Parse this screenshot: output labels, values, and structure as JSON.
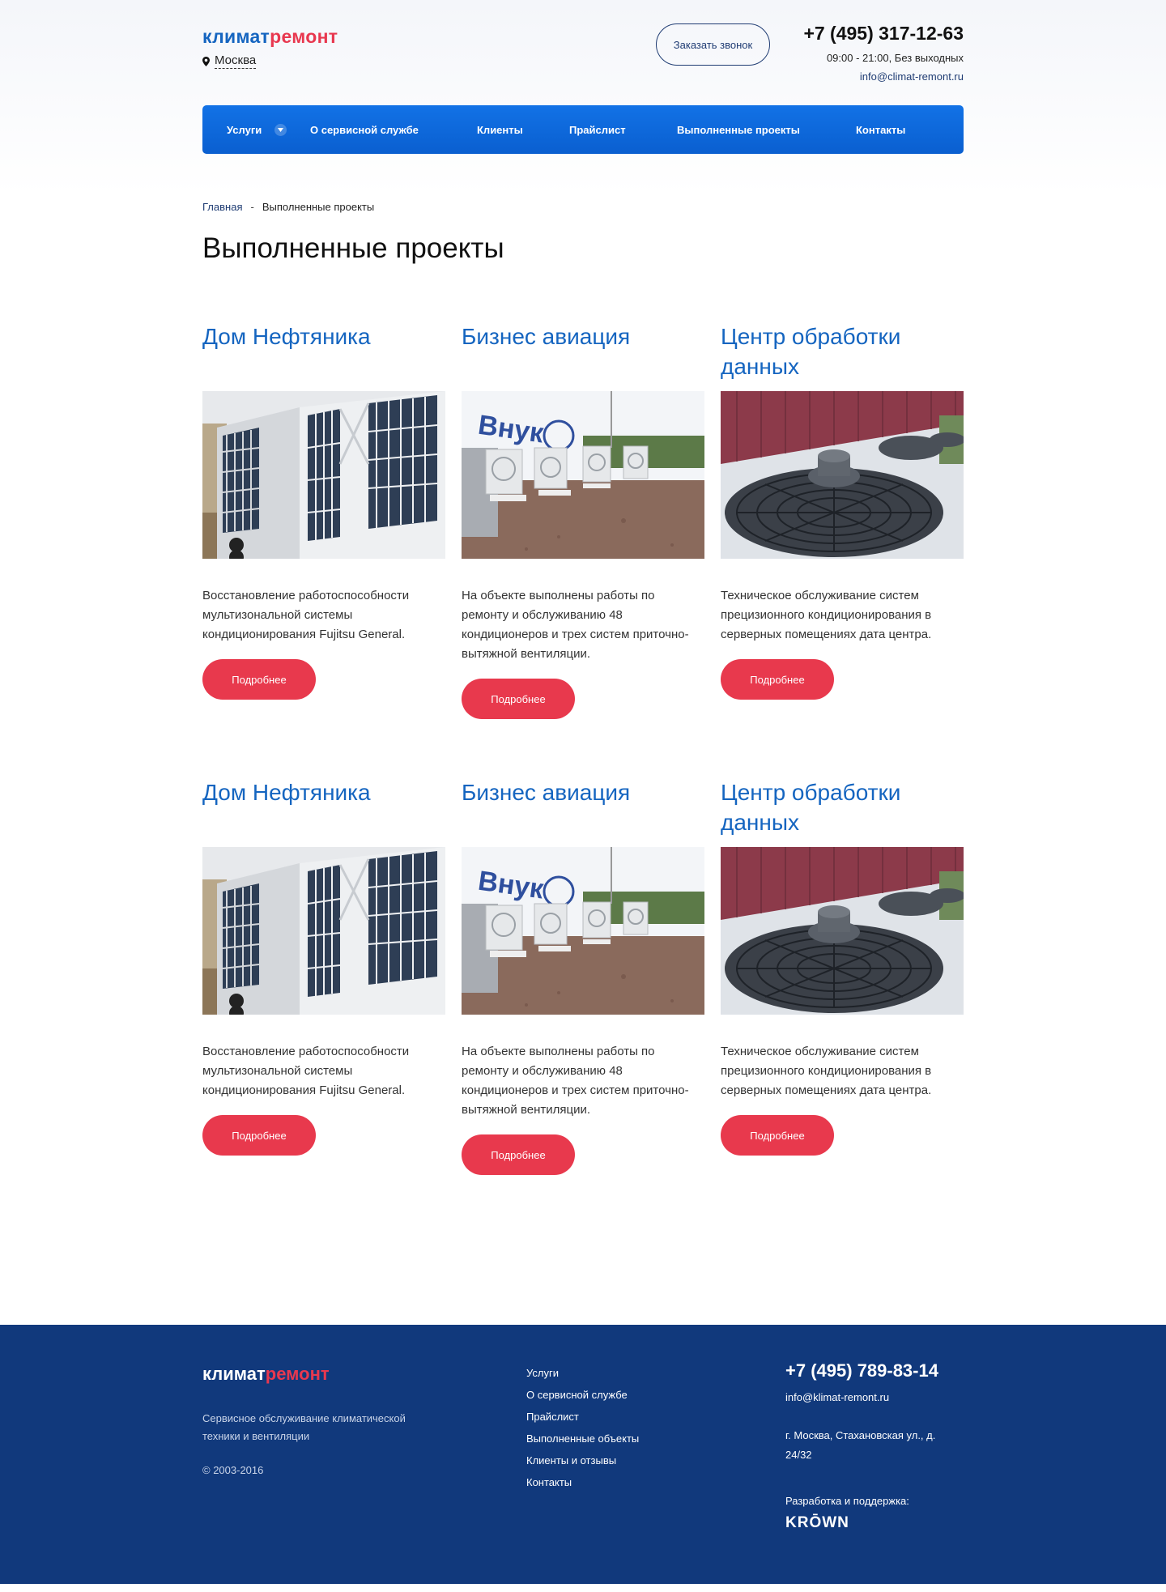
{
  "header": {
    "logo_part1": "климат",
    "logo_part2": "ремонт",
    "city": "Москва",
    "callback_label": "Заказать звонок",
    "phone": "+7 (495) 317-12-63",
    "hours": "09:00 - 21:00, Без выходных",
    "email": "info@climat-remont.ru"
  },
  "nav": {
    "items": [
      "Услуги",
      "О сервисной службе",
      "Клиенты",
      "Прайслист",
      "Выполненные проекты",
      "Контакты"
    ]
  },
  "breadcrumb": {
    "home": "Главная",
    "separator": "-",
    "current": "Выполненные проекты"
  },
  "page_title": "Выполненные проекты",
  "projects": [
    {
      "title": "Дом Нефтяника",
      "image": "outdoor-ac-units-photo",
      "description": "Восстановление работоспособности мультизональной системы кондиционирования Fujitsu General.",
      "button": "Подробнее"
    },
    {
      "title": "Бизнес авиация",
      "image": "rooftop-condensers-photo",
      "description": "На объекте выполнены работы по ремонту и обслуживанию 48 кондиционеров и трех систем приточно-вытяжной вентиляции.",
      "button": "Подробнее"
    },
    {
      "title": "Центр обработки данных",
      "image": "industrial-fans-photo",
      "description": "Техническое обслуживание систем прецизионного кондиционирования в серверных помещениях дата центра.",
      "button": "Подробнее"
    },
    {
      "title": "Дом Нефтяника",
      "image": "outdoor-ac-units-photo",
      "description": "Восстановление работоспособности мультизональной системы кондиционирования Fujitsu General.",
      "button": "Подробнее"
    },
    {
      "title": "Бизнес авиация",
      "image": "rooftop-condensers-photo",
      "description": "На объекте выполнены работы по ремонту и обслуживанию 48 кондиционеров и трех систем приточно-вытяжной вентиляции.",
      "button": "Подробнее"
    },
    {
      "title": "Центр обработки данных",
      "image": "industrial-fans-photo",
      "description": "Техническое обслуживание систем прецизионного кондиционирования в серверных помещениях дата центра.",
      "button": "Подробнее"
    }
  ],
  "footer": {
    "logo_part1": "климат",
    "logo_part2": "ремонт",
    "description": "Сервисное обслуживание климатической техники и вентиляции",
    "copyright": "© 2003-2016",
    "menu": [
      "Услуги",
      "О сервисной службе",
      "Прайслист",
      "Выполненные объекты",
      "Клиенты и отзывы",
      "Контакты"
    ],
    "phone": "+7 (495) 789-83-14",
    "email": "info@klimat-remont.ru",
    "address": "г. Москва, Стахановская ул., д. 24/32",
    "dev_label": "Разработка и поддержка:",
    "dev_logo": "KRŌWN"
  },
  "colors": {
    "brand_blue": "#1565c0",
    "brand_red": "#e8384f",
    "nav_blue": "#0a66dc",
    "button_red": "#e8394d",
    "footer_bg": "#11397c"
  }
}
